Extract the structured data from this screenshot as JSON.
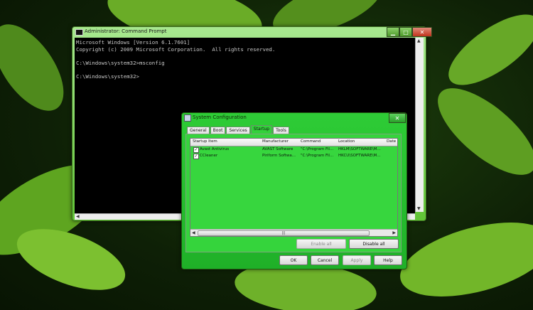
{
  "cmd_window": {
    "title": "Administrator: Command Prompt",
    "lines": [
      "Microsoft Windows [Version 6.1.7601]",
      "Copyright (c) 2009 Microsoft Corporation.  All rights reserved.",
      "",
      "C:\\Windows\\system32>msconfig",
      "",
      "C:\\Windows\\system32>"
    ]
  },
  "msconfig": {
    "title": "System Configuration",
    "tabs": [
      "General",
      "Boot",
      "Services",
      "Startup",
      "Tools"
    ],
    "active_tab": "Startup",
    "columns": [
      "Startup Item",
      "Manufacturer",
      "Command",
      "Location",
      "Date"
    ],
    "rows": [
      {
        "checked": true,
        "item": "Avast Antivirus",
        "manufacturer": "AVAST Software",
        "command": "\"C:\\Program Fil...",
        "location": "HKLM\\SOFTWARE\\M..."
      },
      {
        "checked": true,
        "item": "CCleaner",
        "manufacturer": "Piriform Softwa...",
        "command": "\"C:\\Program Fil...",
        "location": "HKCU\\SOFTWARE\\M..."
      }
    ],
    "enable_all": "Enable all",
    "disable_all": "Disable all",
    "ok": "OK",
    "cancel": "Cancel",
    "apply": "Apply",
    "help": "Help",
    "accent_color": "#2ecc36"
  }
}
